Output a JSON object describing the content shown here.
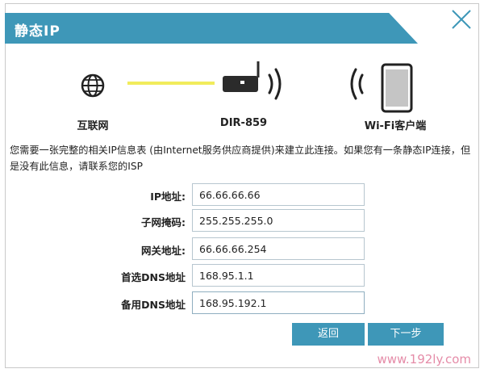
{
  "dialog": {
    "title": "静态IP",
    "close_icon": "close-icon"
  },
  "diagram": {
    "internet_label": "互联网",
    "router_label": "DIR-859",
    "client_label": "Wi-Fi客户端",
    "link_color": "#f1ec5c"
  },
  "description": "您需要一张完整的相关IP信息表 (由Internet服务供应商提供)来建立此连接。如果您有一条静态IP连接，但是没有此信息，请联系您的ISP",
  "fields": [
    {
      "label": "IP地址:",
      "value": "66.66.66.66"
    },
    {
      "label": "子网掩码:",
      "value": "255.255.255.0"
    },
    {
      "label": "网关地址:",
      "value": "66.66.66.254"
    },
    {
      "label": "首选DNS地址",
      "value": "168.95.1.1"
    },
    {
      "label": "备用DNS地址",
      "value": "168.95.192.1"
    }
  ],
  "buttons": {
    "back": "返回",
    "next": "下一步"
  },
  "watermark": "www.192ly.com",
  "colors": {
    "accent": "#3e97b8",
    "watermark": "#e58ca8"
  }
}
